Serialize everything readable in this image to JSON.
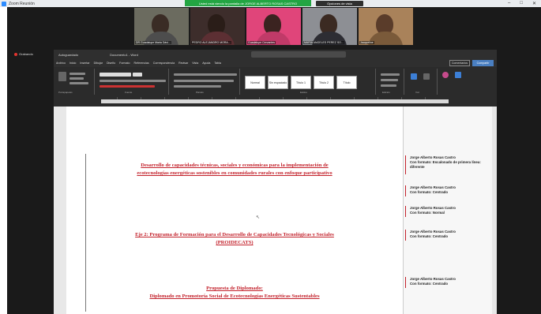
{
  "zoom": {
    "title": "Zoom Reunión",
    "share_banner": "Usted está viendo la pantalla de JORGE ALBERTO ROSAS CASTRO",
    "stop_share": "Opciones de vista",
    "left_label": "Grabando"
  },
  "participants": [
    {
      "name": "DR Guadalupe Maria Dávi..."
    },
    {
      "name": "PEDRO ALEJANDRO MORA..."
    },
    {
      "name": "Guadalupe Cervantes"
    },
    {
      "name": "MARIA ANGELES PEREZ SO..."
    },
    {
      "name": "Jacqueline"
    }
  ],
  "word": {
    "autosave": "Autoguardado",
    "doc_title": "Documento1 - Word",
    "menu": [
      "Archivo",
      "Inicio",
      "Insertar",
      "Dibujar",
      "Diseño",
      "Formato",
      "Referencias",
      "Correspondencia",
      "Revisar",
      "Vista",
      "Ayuda",
      "Tabla"
    ],
    "comments_btn": "Comentarios",
    "share_btn": "Compartir",
    "styles": [
      "Normal",
      "Sin espaciado",
      "Título 1",
      "Título 2",
      "Título"
    ],
    "ribbon_labels": {
      "clipboard": "Portapapeles",
      "font": "Fuente",
      "paragraph": "Párrafo",
      "styles": "Estilos",
      "editing": "Edición",
      "voice": "Voz"
    }
  },
  "document": {
    "heading1_line1": "Desarrollo de capacidades técnicas, sociales y económicas para la implementación de",
    "heading1_line2": "ecotecnologías energéticas sostenibles en comunidades rurales con enfoque participativo",
    "heading2_line1": "Eje 2: Programa de Formación para el Desarrollo de Capacidades Tecnológicas y Sociales",
    "heading2_line2": "(PROIDECATS)",
    "heading3_line1": "Propuesta de Diplomado:",
    "heading3_line2": "Diplomado en Promotoría Social de Ecotecnologías Energéticas Sustentables"
  },
  "comments": [
    {
      "author": "Jorge Alberto Rosas Castro",
      "text": "Con formato: Escalonado de primera línea:",
      "text2": "diferente"
    },
    {
      "author": "Jorge Alberto Rosas Castro",
      "text": "Con formato: Centrado"
    },
    {
      "author": "Jorge Alberto Rosas Castro",
      "text": "Con formato: Normal"
    },
    {
      "author": "Jorge Alberto Rosas Castro",
      "text": "Con formato: Centrado"
    },
    {
      "author": "Jorge Alberto Rosas Castro",
      "text": "Con formato: Centrado"
    }
  ],
  "colors": {
    "heading_red": "#c3222c",
    "share_green": "#23a543",
    "word_dark": "#2f2f2f"
  }
}
